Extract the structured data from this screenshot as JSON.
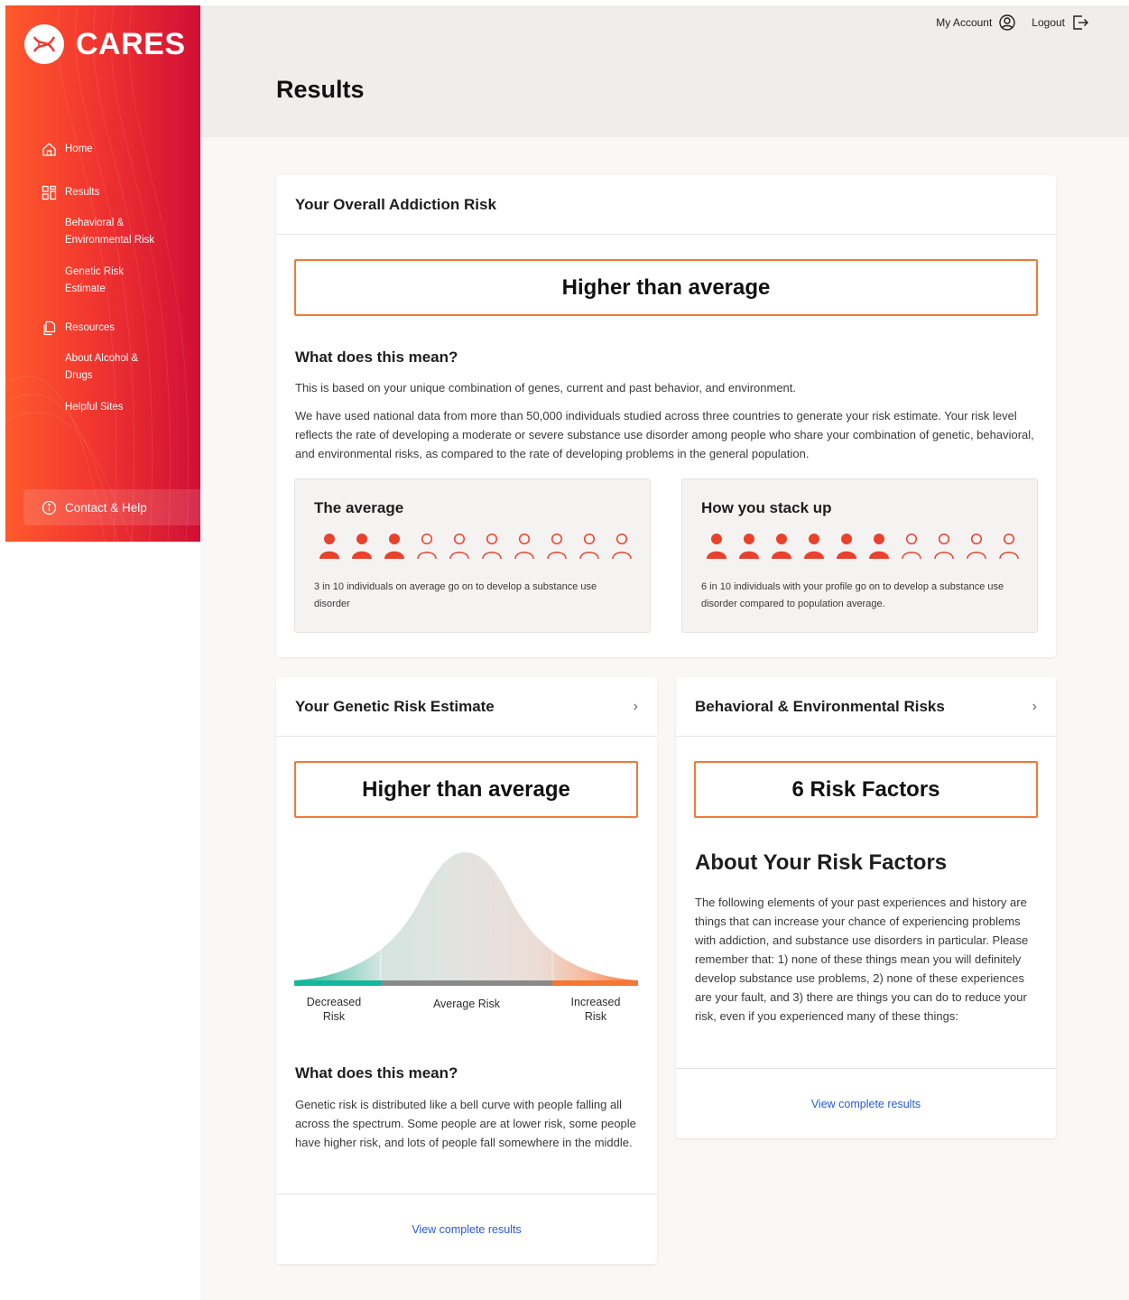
{
  "brand": {
    "name": "CARES"
  },
  "sidebar": {
    "items": [
      {
        "label": "Home",
        "icon": "home-icon"
      },
      {
        "label": "Results",
        "icon": "grid-icon"
      },
      {
        "label": "Behavioral & Environmental Risk"
      },
      {
        "label": "Genetic Risk Estimate"
      },
      {
        "label": "Resources",
        "icon": "documents-icon"
      },
      {
        "label": "About Alcohol & Drugs"
      },
      {
        "label": "Helpful Sites"
      }
    ],
    "contact": {
      "label": "Contact & Help",
      "icon": "info-icon"
    }
  },
  "header": {
    "account_label": "My Account",
    "logout_label": "Logout",
    "title": "Results"
  },
  "overall": {
    "title": "Your Overall Addiction Risk",
    "result": "Higher than average",
    "meaning_title": "What does this mean?",
    "paragraph1": "This is based on your unique combination of genes, current and past behavior, and environment.",
    "paragraph2": "We have used national data from more than 50,000 individuals studied across three countries to generate your risk estimate. Your risk level reflects the rate of developing a moderate or severe substance use disorder among people who share your combination of genetic, behavioral, and environmental risks, as compared to the rate of developing problems in the general population.",
    "average": {
      "title": "The average",
      "filled": 3,
      "total": 10,
      "description": "3 in 10 individuals on average go on to develop a substance use disorder"
    },
    "yours": {
      "title": "How you stack up",
      "filled": 6,
      "total": 10,
      "description": "6 in 10 individuals with your profile go on to develop a substance use disorder compared to population average."
    }
  },
  "genetic": {
    "title": "Your Genetic Risk Estimate",
    "result": "Higher than average",
    "curve_labels": {
      "decreased": "Decreased Risk",
      "average": "Average Risk",
      "increased": "Increased Risk"
    },
    "meaning_title": "What does this mean?",
    "paragraph": "Genetic risk is distributed like a bell curve with people falling all across the spectrum. Some people are at lower risk, some people have higher risk, and lots of people fall somewhere in the middle.",
    "link": "View complete results"
  },
  "behavioral": {
    "title": "Behavioral & Environmental Risks",
    "result": "6 Risk Factors",
    "about_title": "About Your Risk Factors",
    "paragraph": "The following elements of your past experiences and history are things that can increase your chance of experiencing problems with addiction, and substance use disorders in particular. Please remember that: 1) none of these things mean you will definitely develop substance use problems, 2) none of these experiences are your fault, and 3) there are things you can do to reduce your risk, even if you experienced many of these things:",
    "link": "View complete results"
  },
  "colors": {
    "accent": "#f07a3a",
    "person": "#e8412c",
    "link": "#2a5bd7",
    "teal": "#12b89b"
  }
}
